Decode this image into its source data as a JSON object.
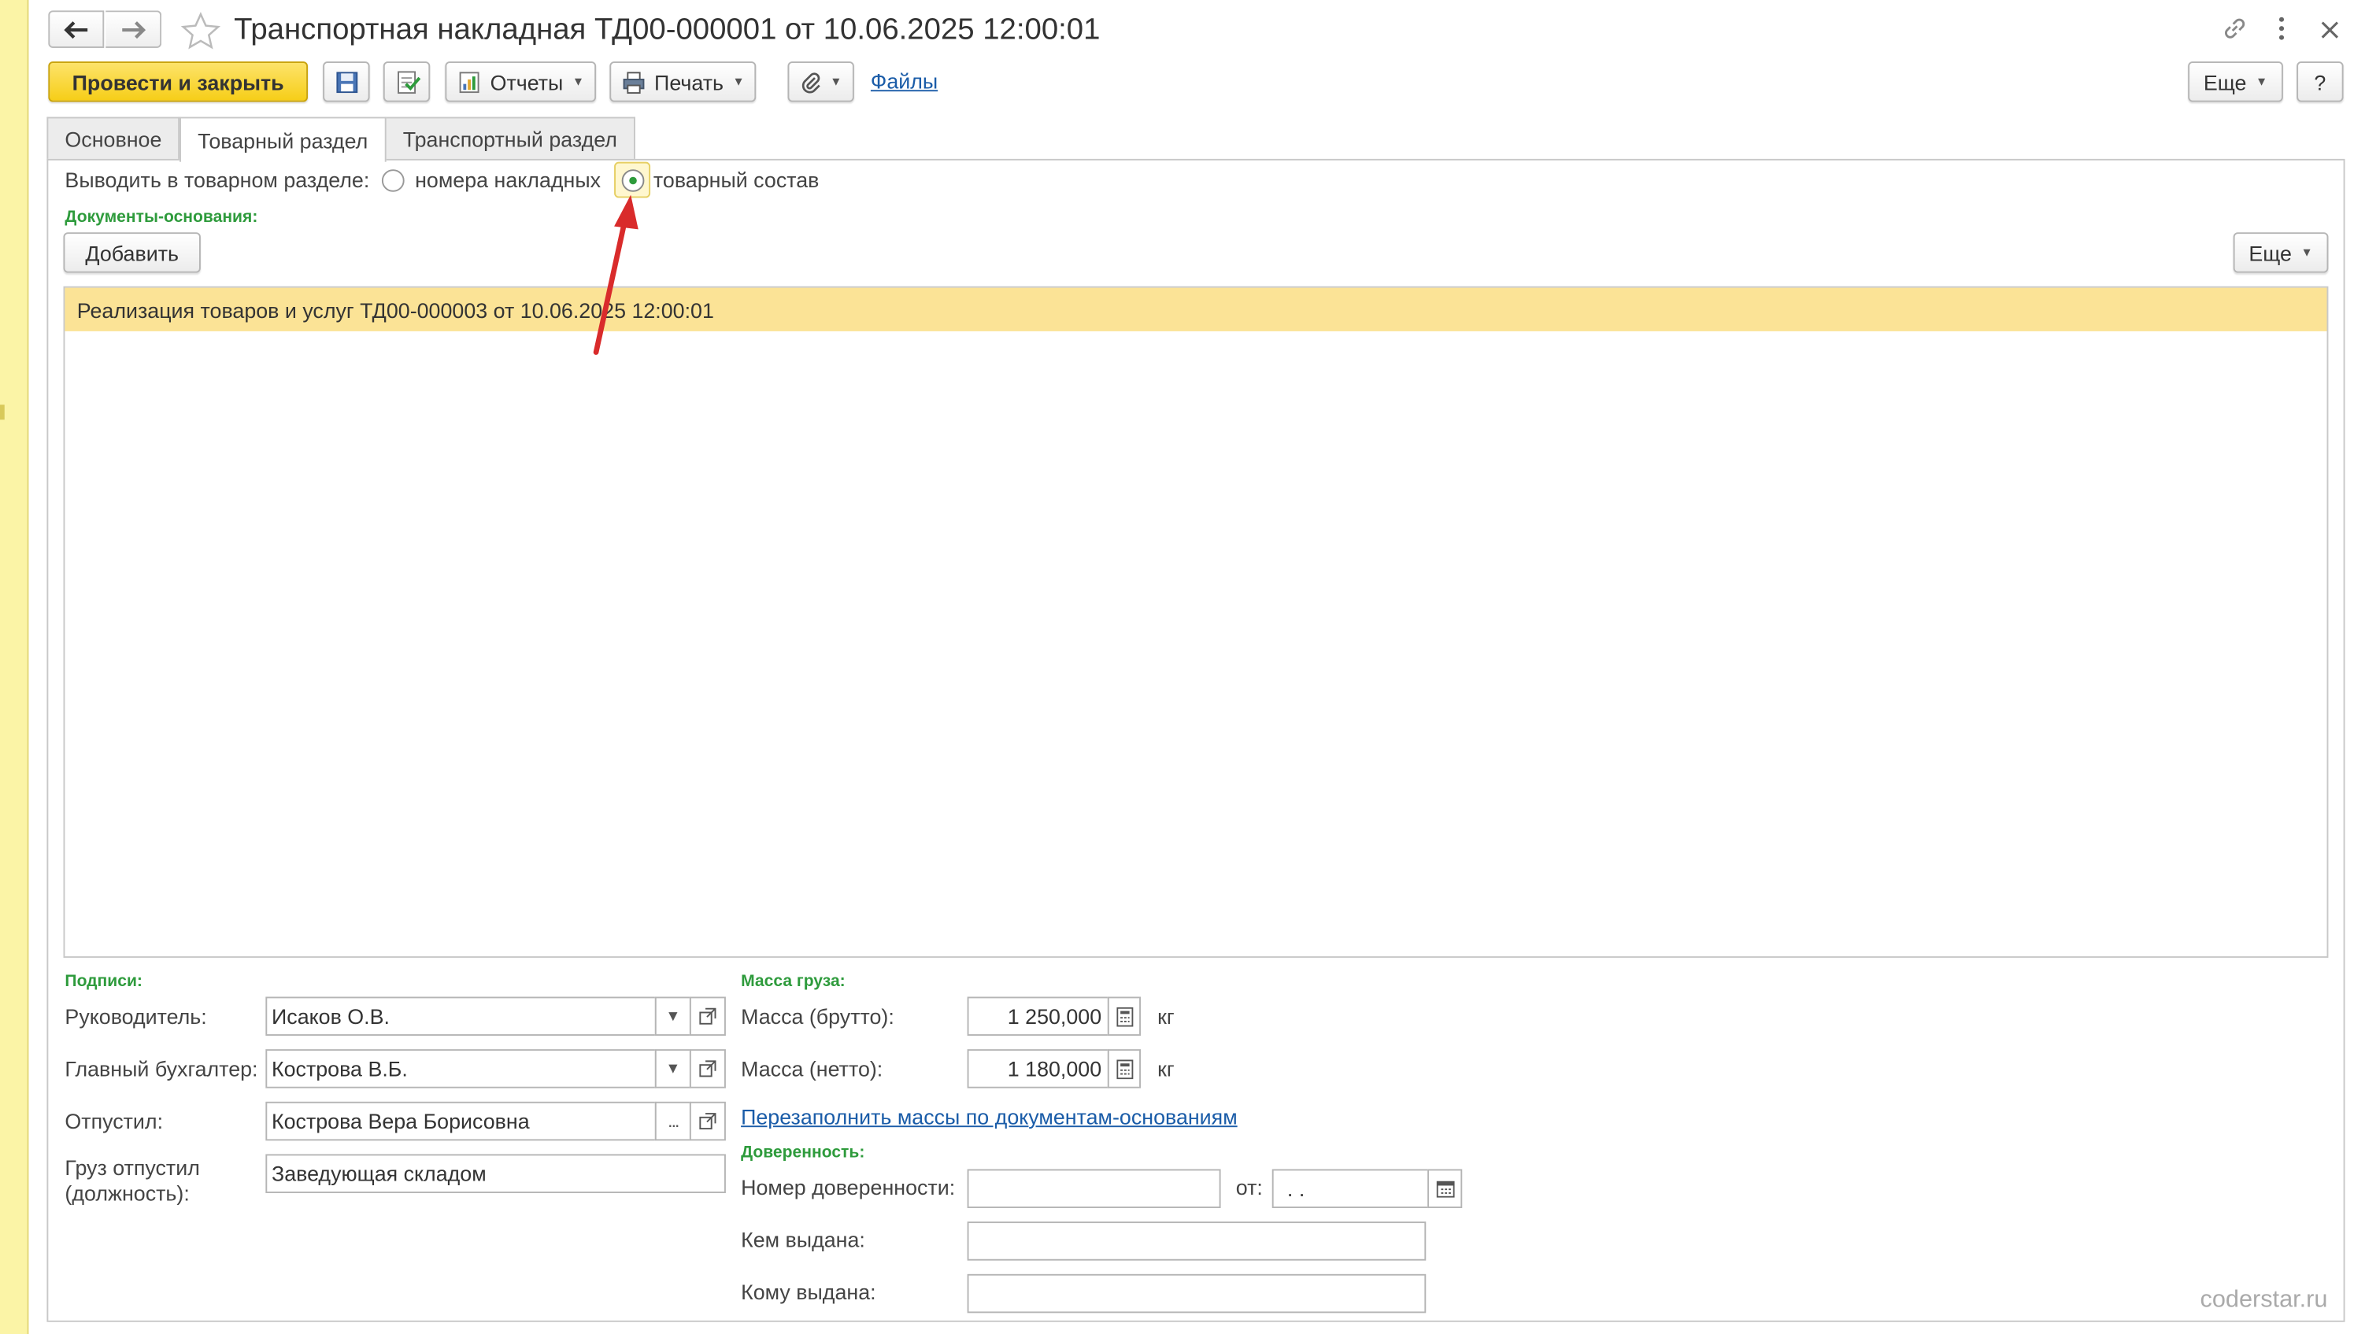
{
  "window": {
    "title": "Транспортная накладная ТД00-000001 от 10.06.2025 12:00:01",
    "icons": [
      "back-icon",
      "forward-icon",
      "star-icon",
      "link-icon",
      "more-vertical-icon",
      "close-icon"
    ]
  },
  "toolbar": {
    "post_close": "Провести и закрыть",
    "reports": "Отчеты",
    "print": "Печать",
    "files": "Файлы",
    "more": "Еще",
    "help": "?"
  },
  "tabs": [
    {
      "label": "Основное",
      "active": false
    },
    {
      "label": "Товарный раздел",
      "active": true
    },
    {
      "label": "Транспортный раздел",
      "active": false
    }
  ],
  "output_mode": {
    "label": "Выводить в товарном разделе:",
    "options": [
      {
        "label": "номера накладных",
        "checked": false
      },
      {
        "label": "товарный состав",
        "checked": true
      }
    ]
  },
  "base_docs": {
    "group_label": "Документы-основания:",
    "add_button": "Добавить",
    "more_button": "Еще",
    "rows": [
      "Реализация товаров и услуг ТД00-000003 от 10.06.2025 12:00:01"
    ]
  },
  "signatures": {
    "group_label": "Подписи:",
    "head_label": "Руководитель:",
    "head_value": "Исаков О.В.",
    "accountant_label": "Главный бухгалтер:",
    "accountant_value": "Кострова В.Б.",
    "released_label": "Отпустил:",
    "released_value": "Кострова Вера Борисовна",
    "position_label": "Груз отпустил (должность):",
    "position_label_line1": "Груз отпустил",
    "position_label_line2": "(должность):",
    "position_value": "Заведующая складом"
  },
  "cargo_mass": {
    "group_label": "Масса груза:",
    "gross_label": "Масса (брутто):",
    "gross_value": "1 250,000",
    "net_label": "Масса (нетто):",
    "net_value": "1 180,000",
    "unit": "кг",
    "refill_link": "Перезаполнить массы по документам-основаниям"
  },
  "power_of_attorney": {
    "group_label": "Доверенность:",
    "number_label": "Номер доверенности:",
    "number_value": "",
    "date_label": "от:",
    "date_value": " .  .",
    "issued_by_label": "Кем выдана:",
    "issued_by_value": "",
    "issued_to_label": "Кому выдана:",
    "issued_to_value": ""
  },
  "watermark": "coderstar.ru",
  "colors": {
    "primary_button": "#f6ce18",
    "selected_row": "#fbe396",
    "group_label": "#2e9b3c",
    "link": "#1a5ca8",
    "annotation_arrow": "#d92b2b"
  }
}
